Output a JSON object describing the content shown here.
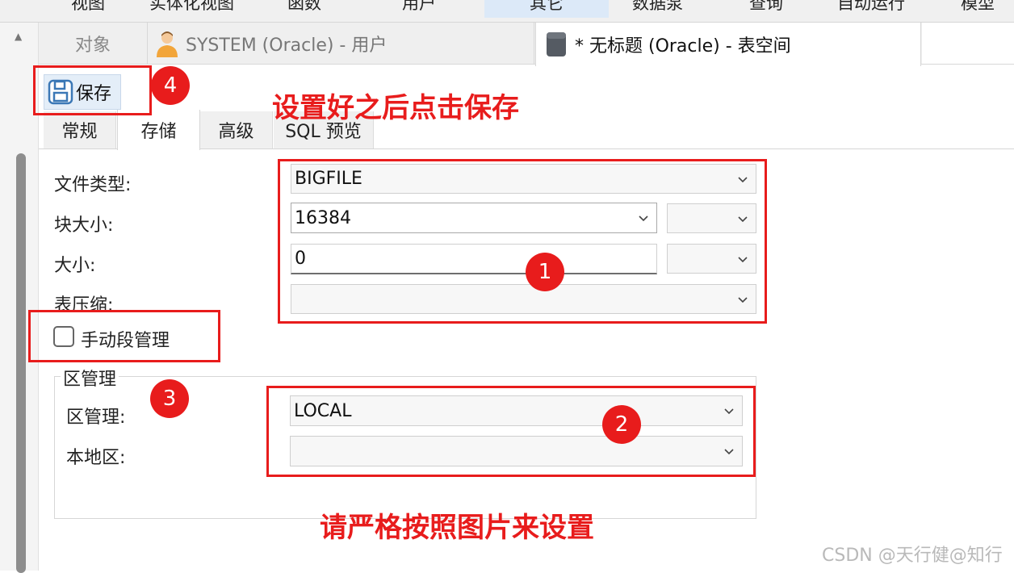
{
  "menu": {
    "items": [
      "视图",
      "实体化视图",
      "函数",
      "用户",
      "其它",
      "数据泵",
      "查询",
      "自动运行",
      "模型"
    ],
    "active_index": 4
  },
  "tabs": {
    "objects": "对象",
    "user_tab": "SYSTEM (Oracle) - 用户",
    "tablespace_tab": "* 无标题 (Oracle) - 表空间"
  },
  "toolbar": {
    "save_label": "保存"
  },
  "subtabs": [
    "常规",
    "存储",
    "高级",
    "SQL 预览"
  ],
  "subtabs_active": 1,
  "form": {
    "file_type": {
      "label": "文件类型:",
      "value": "BIGFILE"
    },
    "block_size": {
      "label": "块大小:",
      "value": "16384",
      "unit": ""
    },
    "size": {
      "label": "大小:",
      "value": "0",
      "unit": ""
    },
    "compression": {
      "label": "表压缩:",
      "value": ""
    },
    "manual_segment": {
      "label": "手动段管理",
      "checked": false
    }
  },
  "extent_group": {
    "title": "区管理",
    "extent_management": {
      "label": "区管理:",
      "value": "LOCAL"
    },
    "local_extent": {
      "label": "本地区:",
      "value": ""
    }
  },
  "annotations": {
    "badge_1": "1",
    "badge_2": "2",
    "badge_3": "3",
    "badge_4": "4",
    "note_save": "设置好之后点击保存",
    "note_strict": "请严格按照图片来设置",
    "color": "#e81c1c"
  },
  "watermark": "CSDN @天行健@知行"
}
